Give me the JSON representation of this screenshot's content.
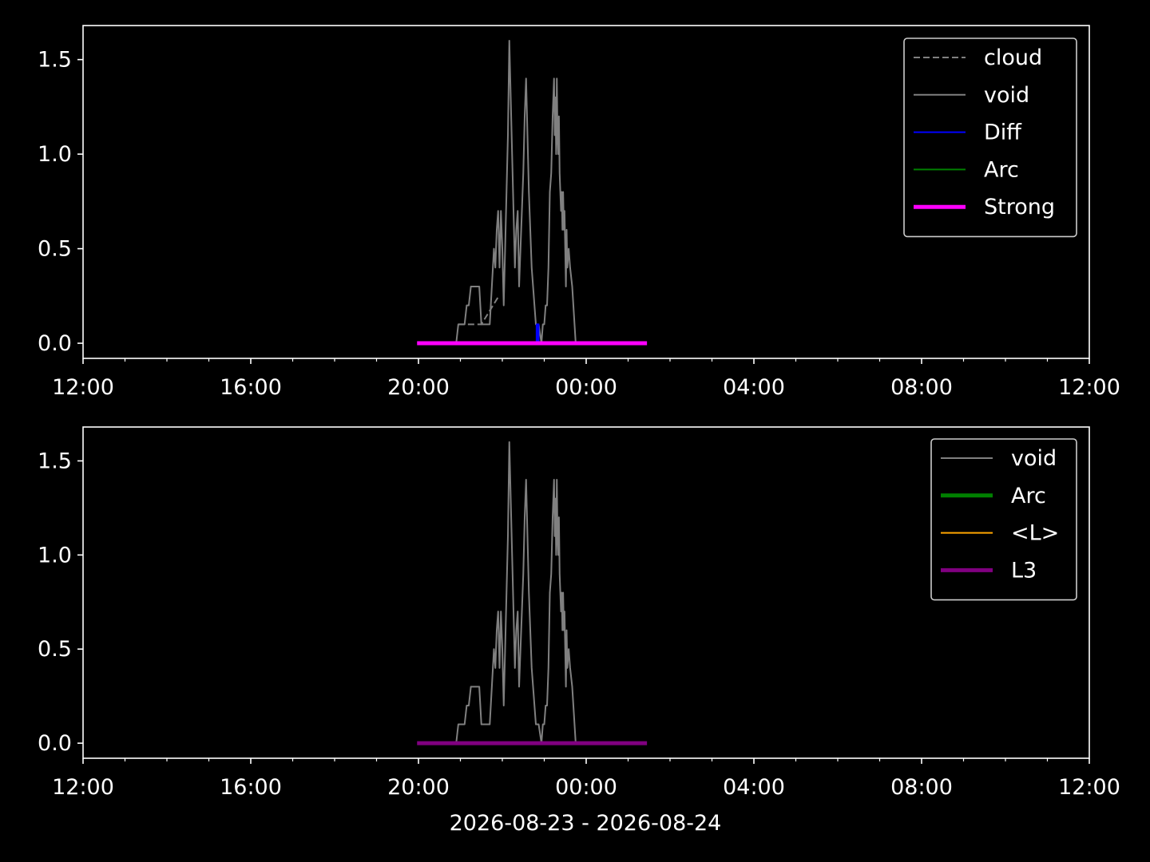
{
  "chart_data": [
    {
      "type": "line",
      "x_range": [
        "2026-08-23 12:00",
        "2026-08-24 12:00"
      ],
      "ylim": [
        -0.08,
        1.68
      ],
      "y_ticks": [
        "0.0",
        "0.5",
        "1.0",
        "1.5"
      ],
      "x_ticks": [
        "12:00",
        "16:00",
        "20:00",
        "00:00",
        "04:00",
        "08:00",
        "12:00"
      ],
      "grid": false,
      "legend_position": "upper right",
      "legend": [
        "cloud",
        "void",
        "Diff",
        "Arc",
        "Strong"
      ],
      "series": [
        {
          "name": "cloud",
          "color": "#808080",
          "style": "dashed",
          "points": [
            [
              "20:57",
              0.1
            ],
            [
              "21:30",
              0.1
            ],
            [
              "21:55",
              0.25
            ]
          ]
        },
        {
          "name": "void",
          "color": "#808080",
          "style": "solid",
          "points": [
            [
              "20:54",
              0.0
            ],
            [
              "20:57",
              0.1
            ],
            [
              "21:06",
              0.1
            ],
            [
              "21:09",
              0.2
            ],
            [
              "21:12",
              0.2
            ],
            [
              "21:15",
              0.3
            ],
            [
              "21:27",
              0.3
            ],
            [
              "21:30",
              0.1
            ],
            [
              "21:42",
              0.1
            ],
            [
              "21:45",
              0.3
            ],
            [
              "21:48",
              0.5
            ],
            [
              "21:50",
              0.4
            ],
            [
              "21:52",
              0.6
            ],
            [
              "21:54",
              0.7
            ],
            [
              "21:56",
              0.4
            ],
            [
              "21:58",
              0.7
            ],
            [
              "22:00",
              0.5
            ],
            [
              "22:02",
              0.2
            ],
            [
              "22:04",
              0.5
            ],
            [
              "22:06",
              0.8
            ],
            [
              "22:08",
              1.1
            ],
            [
              "22:10",
              1.6
            ],
            [
              "22:12",
              1.3
            ],
            [
              "22:14",
              1.0
            ],
            [
              "22:16",
              0.7
            ],
            [
              "22:18",
              0.4
            ],
            [
              "22:20",
              0.6
            ],
            [
              "22:22",
              0.7
            ],
            [
              "22:24",
              0.3
            ],
            [
              "22:26",
              0.5
            ],
            [
              "22:28",
              0.7
            ],
            [
              "22:30",
              0.9
            ],
            [
              "22:32",
              1.2
            ],
            [
              "22:34",
              1.4
            ],
            [
              "22:36",
              1.1
            ],
            [
              "22:38",
              0.8
            ],
            [
              "22:40",
              0.6
            ],
            [
              "22:42",
              0.4
            ],
            [
              "22:44",
              0.3
            ],
            [
              "22:46",
              0.2
            ],
            [
              "22:48",
              0.1
            ],
            [
              "22:52",
              0.1
            ],
            [
              "22:56",
              0.0
            ],
            [
              "22:58",
              0.1
            ],
            [
              "23:00",
              0.1
            ],
            [
              "23:02",
              0.2
            ],
            [
              "23:04",
              0.2
            ],
            [
              "23:06",
              0.4
            ],
            [
              "23:08",
              0.8
            ],
            [
              "23:10",
              0.9
            ],
            [
              "23:12",
              1.2
            ],
            [
              "23:14",
              1.4
            ],
            [
              "23:15",
              1.1
            ],
            [
              "23:16",
              1.3
            ],
            [
              "23:17",
              1.0
            ],
            [
              "23:18",
              1.4
            ],
            [
              "23:19",
              1.1
            ],
            [
              "23:20",
              1.0
            ],
            [
              "23:21",
              1.2
            ],
            [
              "23:22",
              0.9
            ],
            [
              "23:23",
              0.8
            ],
            [
              "23:24",
              0.7
            ],
            [
              "23:25",
              0.8
            ],
            [
              "23:26",
              0.6
            ],
            [
              "23:27",
              0.8
            ],
            [
              "23:28",
              0.6
            ],
            [
              "23:29",
              0.7
            ],
            [
              "23:30",
              0.5
            ],
            [
              "23:31",
              0.3
            ],
            [
              "23:32",
              0.6
            ],
            [
              "23:33",
              0.4
            ],
            [
              "23:35",
              0.5
            ],
            [
              "23:37",
              0.4
            ],
            [
              "23:40",
              0.3
            ],
            [
              "23:45",
              0.0
            ]
          ]
        },
        {
          "name": "Diff",
          "color": "#0000ff",
          "style": "solid",
          "points": [
            [
              "22:49",
              0.0
            ],
            [
              "22:49",
              0.1
            ],
            [
              "22:52",
              0.1
            ],
            [
              "22:52",
              0.0
            ],
            [
              "22:51",
              0.0
            ],
            [
              "22:51",
              0.1
            ],
            [
              "22:50",
              0.1
            ],
            [
              "22:50",
              0.0
            ]
          ]
        },
        {
          "name": "Arc",
          "color": "#008000",
          "style": "solid",
          "points": []
        },
        {
          "name": "Strong",
          "color": "#ff00ff",
          "style": "solid",
          "points": [
            [
              "19:58",
              0.0
            ],
            [
              "01:27",
              0.0
            ]
          ]
        }
      ]
    },
    {
      "type": "line",
      "x_range": [
        "2026-08-23 12:00",
        "2026-08-24 12:00"
      ],
      "ylim": [
        -0.08,
        1.68
      ],
      "y_ticks": [
        "0.0",
        "0.5",
        "1.0",
        "1.5"
      ],
      "x_ticks": [
        "12:00",
        "16:00",
        "20:00",
        "00:00",
        "04:00",
        "08:00",
        "12:00"
      ],
      "xlabel": "2026-08-23 - 2026-08-24",
      "grid": false,
      "legend_position": "upper right",
      "legend": [
        "void",
        "Arc",
        "<L>",
        "L3"
      ],
      "series": [
        {
          "name": "void",
          "color": "#808080",
          "style": "solid",
          "points": [
            [
              "20:54",
              0.0
            ],
            [
              "20:57",
              0.1
            ],
            [
              "21:06",
              0.1
            ],
            [
              "21:09",
              0.2
            ],
            [
              "21:12",
              0.2
            ],
            [
              "21:15",
              0.3
            ],
            [
              "21:27",
              0.3
            ],
            [
              "21:30",
              0.1
            ],
            [
              "21:42",
              0.1
            ],
            [
              "21:45",
              0.3
            ],
            [
              "21:48",
              0.5
            ],
            [
              "21:50",
              0.4
            ],
            [
              "21:52",
              0.6
            ],
            [
              "21:54",
              0.7
            ],
            [
              "21:56",
              0.4
            ],
            [
              "21:58",
              0.7
            ],
            [
              "22:00",
              0.5
            ],
            [
              "22:02",
              0.2
            ],
            [
              "22:04",
              0.5
            ],
            [
              "22:06",
              0.8
            ],
            [
              "22:08",
              1.1
            ],
            [
              "22:10",
              1.6
            ],
            [
              "22:12",
              1.3
            ],
            [
              "22:14",
              1.0
            ],
            [
              "22:16",
              0.7
            ],
            [
              "22:18",
              0.4
            ],
            [
              "22:20",
              0.6
            ],
            [
              "22:22",
              0.7
            ],
            [
              "22:24",
              0.3
            ],
            [
              "22:26",
              0.5
            ],
            [
              "22:28",
              0.7
            ],
            [
              "22:30",
              0.9
            ],
            [
              "22:32",
              1.2
            ],
            [
              "22:34",
              1.4
            ],
            [
              "22:36",
              1.1
            ],
            [
              "22:38",
              0.8
            ],
            [
              "22:40",
              0.6
            ],
            [
              "22:42",
              0.4
            ],
            [
              "22:44",
              0.3
            ],
            [
              "22:46",
              0.2
            ],
            [
              "22:48",
              0.1
            ],
            [
              "22:52",
              0.1
            ],
            [
              "22:56",
              0.0
            ],
            [
              "22:58",
              0.1
            ],
            [
              "23:00",
              0.1
            ],
            [
              "23:02",
              0.2
            ],
            [
              "23:04",
              0.2
            ],
            [
              "23:06",
              0.4
            ],
            [
              "23:08",
              0.8
            ],
            [
              "23:10",
              0.9
            ],
            [
              "23:12",
              1.2
            ],
            [
              "23:14",
              1.4
            ],
            [
              "23:15",
              1.1
            ],
            [
              "23:16",
              1.3
            ],
            [
              "23:17",
              1.0
            ],
            [
              "23:18",
              1.4
            ],
            [
              "23:19",
              1.1
            ],
            [
              "23:20",
              1.0
            ],
            [
              "23:21",
              1.2
            ],
            [
              "23:22",
              0.9
            ],
            [
              "23:23",
              0.8
            ],
            [
              "23:24",
              0.7
            ],
            [
              "23:25",
              0.8
            ],
            [
              "23:26",
              0.6
            ],
            [
              "23:27",
              0.8
            ],
            [
              "23:28",
              0.6
            ],
            [
              "23:29",
              0.7
            ],
            [
              "23:30",
              0.5
            ],
            [
              "23:31",
              0.3
            ],
            [
              "23:32",
              0.6
            ],
            [
              "23:33",
              0.4
            ],
            [
              "23:35",
              0.5
            ],
            [
              "23:37",
              0.4
            ],
            [
              "23:40",
              0.3
            ],
            [
              "23:45",
              0.0
            ]
          ]
        },
        {
          "name": "Arc",
          "color": "#008000",
          "style": "solid",
          "points": []
        },
        {
          "name": "<L>",
          "color": "#ffa500",
          "style": "solid",
          "points": []
        },
        {
          "name": "L3",
          "color": "#800080",
          "style": "solid",
          "points": [
            [
              "19:58",
              0.0
            ],
            [
              "01:27",
              0.0
            ]
          ]
        }
      ]
    }
  ]
}
